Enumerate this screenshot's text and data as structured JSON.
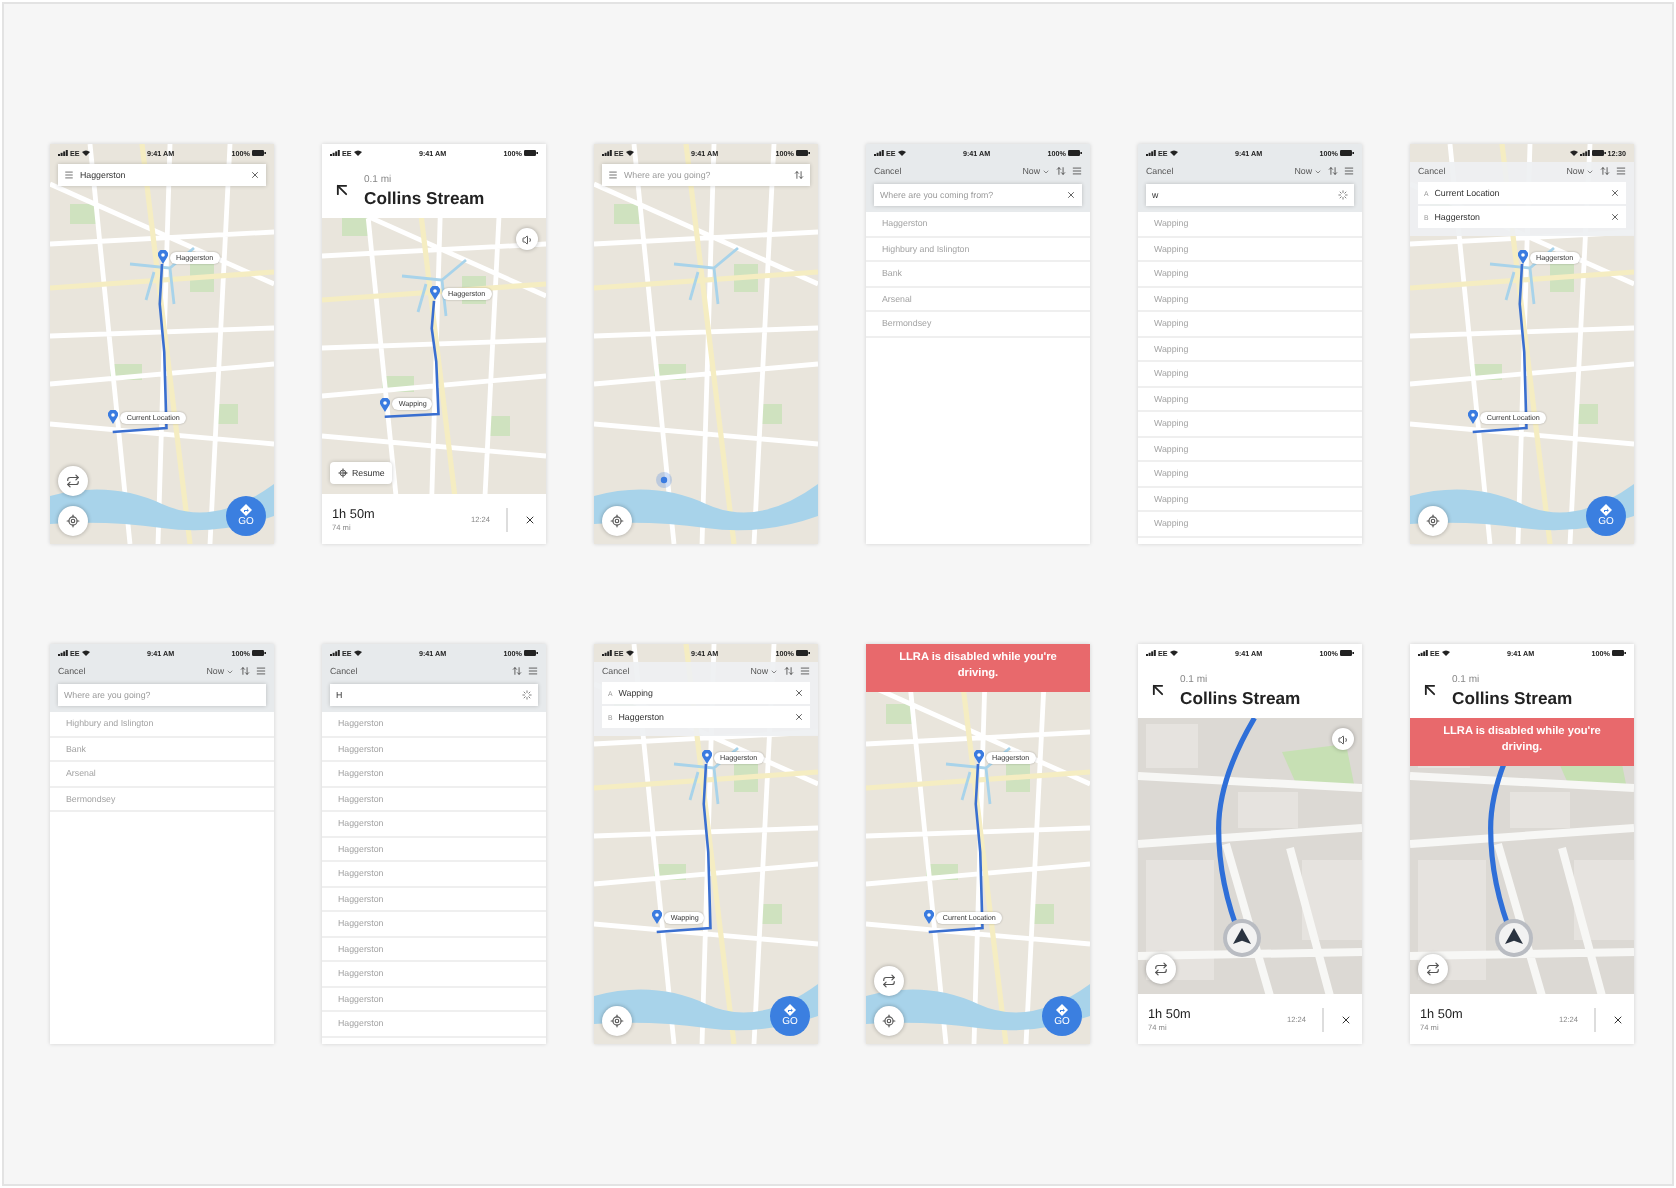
{
  "screens": [
    {
      "kind": "map",
      "status": {
        "carrier": "EE",
        "time": "9:41 AM",
        "battery": "100%"
      },
      "search_bar": {
        "value": "Haggerston",
        "close_icon": true
      },
      "pins": [
        {
          "label": "Haggerston"
        },
        {
          "label": "Current Location"
        }
      ],
      "swap_button": true,
      "go_button": "GO"
    },
    {
      "kind": "nav",
      "status": {
        "carrier": "EE",
        "time": "9:41 AM",
        "battery": "100%"
      },
      "maneuver": {
        "distance": "0.1 mi",
        "street": "Collins Stream"
      },
      "pins": [
        {
          "label": "Haggerston"
        },
        {
          "label": "Wapping"
        }
      ],
      "sound_button": true,
      "resume_button": "Resume",
      "trip": {
        "duration": "1h 50m",
        "distance": "74 mi",
        "eta": "12:24"
      }
    },
    {
      "kind": "map",
      "status": {
        "carrier": "EE",
        "time": "9:41 AM",
        "battery": "100%"
      },
      "search_bar": {
        "placeholder": "Where are you going?",
        "swap_icon": true
      },
      "location_dot": true
    },
    {
      "kind": "search",
      "status": {
        "carrier": "EE",
        "time": "9:41 AM",
        "battery": "100%"
      },
      "header": {
        "cancel": "Cancel",
        "time_option": "Now"
      },
      "field": {
        "placeholder": "Where are you coming from?",
        "close_icon": true
      },
      "results": [
        "Haggerston",
        "Highbury and Islington",
        "Bank",
        "Arsenal",
        "Bermondsey"
      ]
    },
    {
      "kind": "search",
      "status": {
        "carrier": "EE",
        "time": "9:41 AM",
        "battery": "100%"
      },
      "header": {
        "cancel": "Cancel",
        "time_option": "Now"
      },
      "field": {
        "value": "w",
        "loading": true
      },
      "results": [
        "Wapping",
        "Wapping",
        "Wapping",
        "Wapping",
        "Wapping",
        "Wapping",
        "Wapping",
        "Wapping",
        "Wapping",
        "Wapping",
        "Wapping",
        "Wapping",
        "Wapping"
      ]
    },
    {
      "kind": "map",
      "status": {
        "time": "12:30",
        "clock_right": true
      },
      "route_form": {
        "cancel": "Cancel",
        "time_option": "Now",
        "fields": [
          {
            "marker": "A",
            "value": "Current Location"
          },
          {
            "marker": "B",
            "value": "Haggerston"
          }
        ]
      },
      "pins": [
        {
          "label": "Haggerston"
        },
        {
          "label": "Current Location"
        }
      ],
      "go_button": "GO"
    },
    {
      "kind": "search",
      "status": {
        "carrier": "EE",
        "time": "9:41 AM",
        "battery": "100%"
      },
      "header": {
        "cancel": "Cancel",
        "time_option": "Now"
      },
      "field": {
        "placeholder": "Where are you going?"
      },
      "results": [
        "Highbury and Islington",
        "Bank",
        "Arsenal",
        "Bermondsey"
      ]
    },
    {
      "kind": "search",
      "status": {
        "carrier": "EE",
        "time": "9:41 AM",
        "battery": "100%"
      },
      "header": {
        "cancel": "Cancel"
      },
      "field": {
        "value": "H",
        "loading": true
      },
      "results": [
        "Haggerston",
        "Haggerston",
        "Haggerston",
        "Haggerston",
        "Haggerston",
        "Haggerston",
        "Haggerston",
        "Haggerston",
        "Haggerston",
        "Haggerston",
        "Haggerston",
        "Haggerston",
        "Haggerston"
      ]
    },
    {
      "kind": "map",
      "status": {
        "carrier": "EE",
        "time": "9:41 AM",
        "battery": "100%"
      },
      "route_form": {
        "cancel": "Cancel",
        "time_option": "Now",
        "fields": [
          {
            "marker": "A",
            "value": "Wapping"
          },
          {
            "marker": "B",
            "value": "Haggerston"
          }
        ]
      },
      "pins": [
        {
          "label": "Haggerston"
        },
        {
          "label": "Wapping"
        }
      ],
      "go_button": "GO"
    },
    {
      "kind": "map",
      "banner": "LLRA is disabled while you're driving.",
      "pins": [
        {
          "label": "Haggerston"
        },
        {
          "label": "Current Location"
        }
      ],
      "swap_button": true,
      "go_button": "GO"
    },
    {
      "kind": "nav",
      "close_up": true,
      "status": {
        "carrier": "EE",
        "time": "9:41 AM",
        "battery": "100%"
      },
      "maneuver": {
        "distance": "0.1 mi",
        "street": "Collins Stream"
      },
      "sound_button": true,
      "swap_button": true,
      "trip": {
        "duration": "1h 50m",
        "distance": "74 mi",
        "eta": "12:24"
      }
    },
    {
      "kind": "nav",
      "close_up": true,
      "status": {
        "carrier": "EE",
        "time": "9:41 AM",
        "battery": "100%"
      },
      "maneuver": {
        "distance": "0.1 mi",
        "street": "Collins Stream"
      },
      "banner": "LLRA is disabled while you're driving.",
      "swap_button": true,
      "trip": {
        "duration": "1h 50m",
        "distance": "74 mi",
        "eta": "12:24"
      }
    }
  ]
}
